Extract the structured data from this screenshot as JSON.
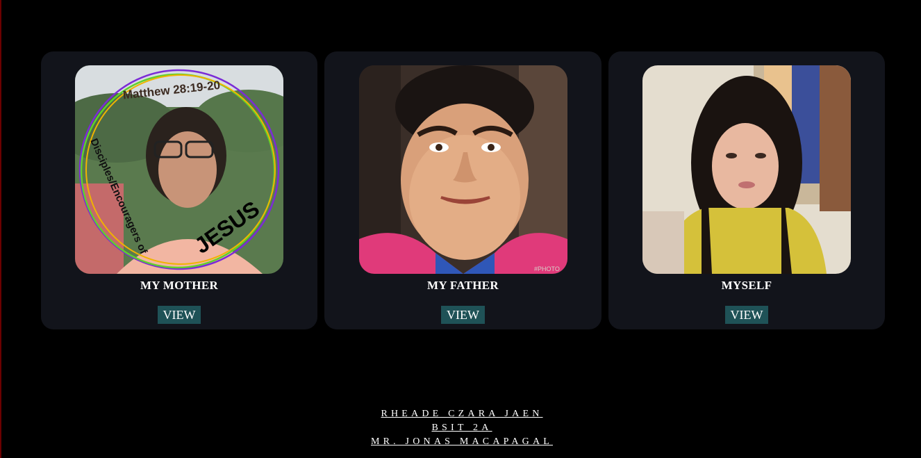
{
  "cards": [
    {
      "title": "MY MOTHER",
      "button": "VIEW",
      "photo_text_top": "Matthew 28:19-20",
      "photo_text_left": "Disciples/Encouragers of",
      "photo_text_big": "JESUS"
    },
    {
      "title": "MY FATHER",
      "button": "VIEW",
      "photo_watermark": "#PHOTO"
    },
    {
      "title": "MYSELF",
      "button": "VIEW"
    }
  ],
  "footer": {
    "name": "RHEADE CZARA JAEN",
    "section": "BSIT 2A",
    "instructor": "MR. JONAS MACAPAGAL"
  }
}
